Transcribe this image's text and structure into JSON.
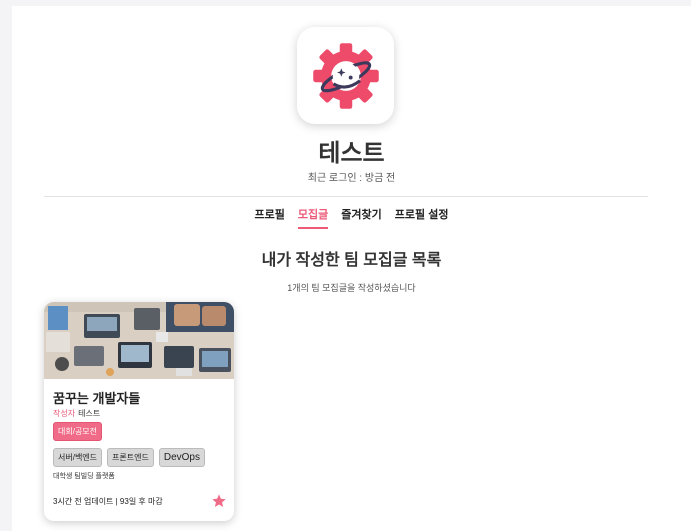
{
  "profile": {
    "name": "테스트",
    "last_login": "최근 로그인 : 방금 전"
  },
  "tabs": [
    {
      "label": "프로필",
      "active": false
    },
    {
      "label": "모집글",
      "active": true
    },
    {
      "label": "즐겨찾기",
      "active": false
    },
    {
      "label": "프로필 설정",
      "active": false
    }
  ],
  "section": {
    "title": "내가 작성한 팀 모집글 목록",
    "subtitle": "1개의 팀 모집글을 작성하셨습니다"
  },
  "post": {
    "title": "꿈꾸는 개발자들",
    "author_label": "작성자",
    "author": "테스트",
    "category": "대회/공모전",
    "tags": [
      "서버/백엔드",
      "프론트엔드",
      "DevOps"
    ],
    "description": "대학생 팀빌딩 플랫폼",
    "footer": "3시간 전 업데이트 | 93일 후 마감",
    "favorited": true
  },
  "colors": {
    "accent": "#ec5a78",
    "logo_gear": "#ee4a6a",
    "logo_planet": "#3b3a5c",
    "star": "#f06b87"
  },
  "icons": {
    "logo": "gear-planet-logo",
    "favorite": "star-icon"
  }
}
